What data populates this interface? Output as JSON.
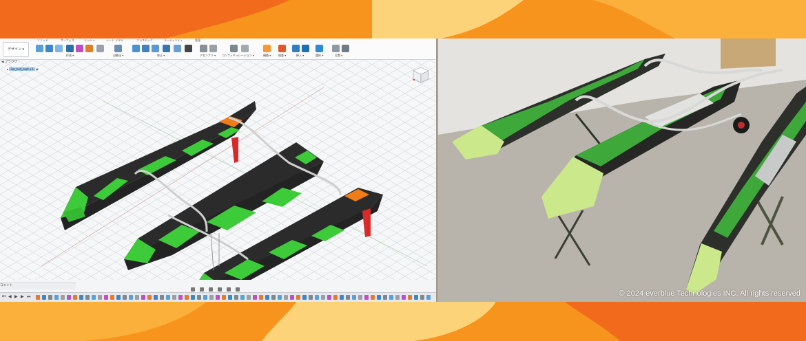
{
  "cad": {
    "workspace_label": "デザイン ▾",
    "tabs": [
      "ソリッド",
      "サーフェス",
      "メッシュ",
      "シート メタル",
      "プラスチック",
      "ユーティリティ",
      "管理"
    ],
    "toolbar_groups": [
      "作成 ▾",
      "自動化 ▾",
      "修正 ▾",
      "アセンブリ ▾",
      "コンフィギュレーション ▾",
      "構築 ▾",
      "検査 ▾",
      "挿入 ▾",
      "選択 ▾",
      "位置 ▾"
    ],
    "browser_title": "ブラウザ",
    "browser_item": "3m_hull_sept v.1",
    "comments_label": "コメント",
    "colors": {
      "hull_green": "#3ecb3a",
      "hull_black": "#2b2b2b",
      "rudder_red": "#d92a2a",
      "accent_orange": "#f07c17",
      "active_tab": "#0a74c2"
    },
    "icons": [
      "sketch-icon",
      "extrude-icon",
      "fillet-icon",
      "move-icon",
      "plane-icon",
      "measure-icon",
      "insert-icon",
      "select-icon"
    ]
  },
  "photo": {
    "copyright": "© 2024 everblue Technologies INC. All rights reserved"
  },
  "background": {
    "colors": [
      "#f7941d",
      "#fbb03b",
      "#f26a1b",
      "#fdd37a"
    ]
  }
}
